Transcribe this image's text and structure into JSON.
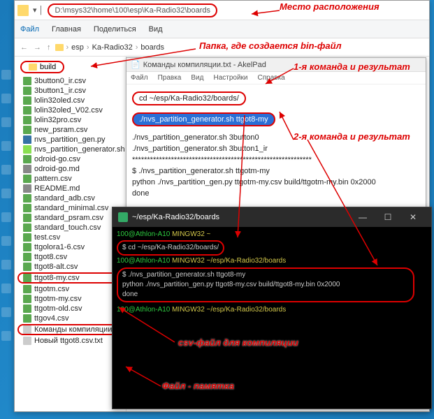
{
  "annotations": {
    "location": "Место расположения",
    "folder_bin": "Папка, где создается bin-файл",
    "cmd1": "1-я команда и результат",
    "cmd2": "2-я команда и результат",
    "csv_label": "csv-файл для компиляции",
    "memo": "Файл - памятка"
  },
  "explorer": {
    "address": "D:\\msys32\\home\\100\\esp\\Ka-Radio32\\boards",
    "ribbon": {
      "file": "Файл",
      "home": "Главная",
      "share": "Поделиться",
      "view": "Вид"
    },
    "crumbs": [
      "esp",
      "Ka-Radio32",
      "boards"
    ],
    "build_folder": "build",
    "files": [
      {
        "n": "3button0_ir.csv",
        "t": "csv"
      },
      {
        "n": "3button1_ir.csv",
        "t": "csv"
      },
      {
        "n": "lolin32oled.csv",
        "t": "csv"
      },
      {
        "n": "lolin32oled_V02.csv",
        "t": "csv"
      },
      {
        "n": "lolin32pro.csv",
        "t": "csv"
      },
      {
        "n": "new_psram.csv",
        "t": "csv"
      },
      {
        "n": "nvs_partition_gen.py",
        "t": "py"
      },
      {
        "n": "nvs_partition_generator.sh",
        "t": "sh"
      },
      {
        "n": "odroid-go.csv",
        "t": "csv"
      },
      {
        "n": "odroid-go.md",
        "t": "md"
      },
      {
        "n": "pattern.csv",
        "t": "csv"
      },
      {
        "n": "README.md",
        "t": "md"
      },
      {
        "n": "standard_adb.csv",
        "t": "csv"
      },
      {
        "n": "standard_minimal.csv",
        "t": "csv"
      },
      {
        "n": "standard_psram.csv",
        "t": "csv"
      },
      {
        "n": "standard_touch.csv",
        "t": "csv"
      },
      {
        "n": "test.csv",
        "t": "csv"
      },
      {
        "n": "ttgolora1-6.csv",
        "t": "csv"
      },
      {
        "n": "ttgot8.csv",
        "t": "csv"
      },
      {
        "n": "ttgot8-alt.csv",
        "t": "csv"
      },
      {
        "n": "ttgot8-my.csv",
        "t": "csv",
        "hl": true
      },
      {
        "n": "ttgotm.csv",
        "t": "csv"
      },
      {
        "n": "ttgotm-my.csv",
        "t": "csv"
      },
      {
        "n": "ttgotm-old.csv",
        "t": "csv"
      },
      {
        "n": "ttgov4.csv",
        "t": "csv"
      },
      {
        "n": "Команды компиляции.txt",
        "t": "txt",
        "hl": true
      },
      {
        "n": "Новый ttgot8.csv.txt",
        "t": "txt"
      }
    ]
  },
  "akelpad": {
    "title": "Команды компиляции.txt - AkelPad",
    "menu": [
      "Файл",
      "Правка",
      "Вид",
      "Настройки",
      "Справка"
    ],
    "cmd1": "cd ~/esp/Ka-Radio32/boards/",
    "cmd2": "./nvs_partition_generator.sh ttgot8-my",
    "l1": "./nvs_partition_generator.sh 3button0",
    "l2": "./nvs_partition_generator.sh 3button1_ir",
    "stars": "************************************************************",
    "l3": "$ ./nvs_partition_generator.sh ttgotm-my",
    "l4": "python ./nvs_partition_gen.py ttgotm-my.csv build/ttgotm-my.bin 0x2000",
    "l5": "done"
  },
  "terminal": {
    "title": "~/esp/Ka-Radio32/boards",
    "ctrls": {
      "min": "—",
      "max": "☐",
      "close": "✕"
    },
    "prompt_user": "100@Athlon-A10 ",
    "prompt_env": "MINGW32",
    "prompt_tilde": " ~",
    "prompt_path": " ~/esp/Ka-Radio32/boards",
    "cmd1": "$ cd ~/esp/Ka-Radio32/boards/",
    "cmd2a": "$ ./nvs_partition_generator.sh ttgot8-my",
    "cmd2b": "python ./nvs_partition_gen.py ttgot8-my.csv build/ttgot8-my.bin 0x2000",
    "cmd2c": "done"
  }
}
